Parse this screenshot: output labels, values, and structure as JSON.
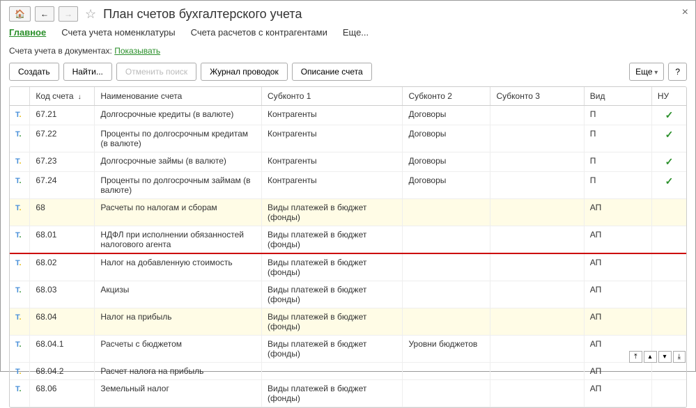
{
  "title": "План счетов бухгалтерского учета",
  "tabs": {
    "main": "Главное",
    "nomen": "Счета учета номенклатуры",
    "contr": "Счета расчетов с контрагентами",
    "more": "Еще..."
  },
  "subline": {
    "label": "Счета учета в документах:",
    "link": "Показывать"
  },
  "toolbar": {
    "create": "Создать",
    "find": "Найти",
    "cancel": "Отменить поиск",
    "journal": "Журнал проводок",
    "desc": "Описание счета",
    "more": "Еще",
    "help": "?"
  },
  "columns": {
    "code": "Код счета",
    "name": "Наименование счета",
    "sk1": "Субконто 1",
    "sk2": "Субконто 2",
    "sk3": "Субконто 3",
    "vid": "Вид",
    "nu": "НУ"
  },
  "rows": [
    {
      "code": "67.21",
      "name": "Долгосрочные кредиты (в валюте)",
      "sk1": "Контрагенты",
      "sk2": "Договоры",
      "sk3": "",
      "vid": "П",
      "nu": true,
      "hl": false
    },
    {
      "code": "67.22",
      "name": "Проценты по долгосрочным кредитам (в валюте)",
      "sk1": "Контрагенты",
      "sk2": "Договоры",
      "sk3": "",
      "vid": "П",
      "nu": true,
      "hl": false
    },
    {
      "code": "67.23",
      "name": "Долгосрочные займы (в валюте)",
      "sk1": "Контрагенты",
      "sk2": "Договоры",
      "sk3": "",
      "vid": "П",
      "nu": true,
      "hl": false
    },
    {
      "code": "67.24",
      "name": "Проценты по долгосрочным займам (в валюте)",
      "sk1": "Контрагенты",
      "sk2": "Договоры",
      "sk3": "",
      "vid": "П",
      "nu": true,
      "hl": false
    },
    {
      "code": "68",
      "name": "Расчеты по налогам и сборам",
      "sk1": "Виды платежей в бюджет (фонды)",
      "sk2": "",
      "sk3": "",
      "vid": "АП",
      "nu": false,
      "hl": true
    },
    {
      "code": "68.01",
      "name": "НДФЛ при исполнении обязанностей налогового агента",
      "sk1": "Виды платежей в бюджет (фонды)",
      "sk2": "",
      "sk3": "",
      "vid": "АП",
      "nu": false,
      "hl": false,
      "redline": true
    },
    {
      "code": "68.02",
      "name": "Налог на добавленную стоимость",
      "sk1": "Виды платежей в бюджет (фонды)",
      "sk2": "",
      "sk3": "",
      "vid": "АП",
      "nu": false,
      "hl": false
    },
    {
      "code": "68.03",
      "name": "Акцизы",
      "sk1": "Виды платежей в бюджет (фонды)",
      "sk2": "",
      "sk3": "",
      "vid": "АП",
      "nu": false,
      "hl": false
    },
    {
      "code": "68.04",
      "name": "Налог на прибыль",
      "sk1": "Виды платежей в бюджет (фонды)",
      "sk2": "",
      "sk3": "",
      "vid": "АП",
      "nu": false,
      "hl": true
    },
    {
      "code": "68.04.1",
      "name": "Расчеты с бюджетом",
      "sk1": "Виды платежей в бюджет (фонды)",
      "sk2": "Уровни бюджетов",
      "sk3": "",
      "vid": "АП",
      "nu": false,
      "hl": false
    },
    {
      "code": "68.04.2",
      "name": "Расчет налога на прибыль",
      "sk1": "",
      "sk2": "",
      "sk3": "",
      "vid": "АП",
      "nu": false,
      "hl": false
    },
    {
      "code": "68.06",
      "name": "Земельный налог",
      "sk1": "Виды платежей в бюджет (фонды)",
      "sk2": "",
      "sk3": "",
      "vid": "АП",
      "nu": false,
      "hl": false
    }
  ],
  "nav": {
    "first": "▲̲",
    "prev": "▲",
    "next": "▼",
    "last": "▼̲"
  }
}
